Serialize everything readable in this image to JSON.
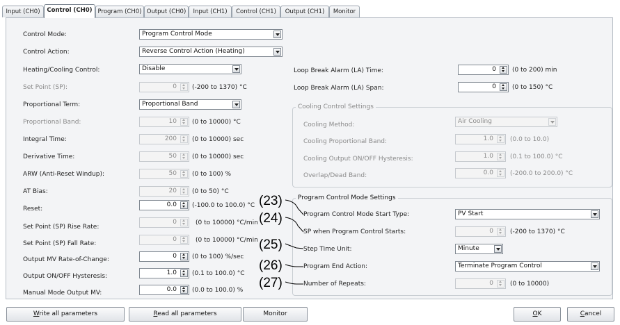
{
  "tabs": [
    {
      "label": "Input (CH0)",
      "active": false
    },
    {
      "label": "Control (CH0)",
      "active": true
    },
    {
      "label": "Program (CH0)",
      "active": false
    },
    {
      "label": "Output (CH0)",
      "active": false
    },
    {
      "label": "Input (CH1)",
      "active": false
    },
    {
      "label": "Control (CH1)",
      "active": false
    },
    {
      "label": "Output (CH1)",
      "active": false
    },
    {
      "label": "Monitor",
      "active": false
    }
  ],
  "left": {
    "control_mode": {
      "label": "Control Mode:",
      "value": "Program Control Mode"
    },
    "control_action": {
      "label": "Control Action:",
      "value": "Reverse Control Action (Heating)"
    },
    "heating_cooling": {
      "label": "Heating/Cooling Control:",
      "value": "Disable"
    },
    "set_point": {
      "label": "Set Point (SP):",
      "value": "0",
      "range": "(-200 to 1370) °C"
    },
    "proportional_term": {
      "label": "Proportional Term:",
      "value": "Proportional Band"
    },
    "proportional_band": {
      "label": "Proportional Band:",
      "value": "10",
      "range": "(0 to 10000) °C"
    },
    "integral_time": {
      "label": "Integral Time:",
      "value": "200",
      "range": "(0 to 10000) sec"
    },
    "derivative_time": {
      "label": "Derivative Time:",
      "value": "50",
      "range": "(0 to 10000) sec"
    },
    "arw": {
      "label": "ARW (Anti-Reset Windup):",
      "value": "50",
      "range": "(0 to 100) %"
    },
    "at_bias": {
      "label": "AT Bias:",
      "value": "20",
      "range": "(0 to 50) °C"
    },
    "reset": {
      "label": "Reset:",
      "value": "0.0",
      "range": "(-100.0 to 100.0) °C"
    },
    "sp_rise_rate": {
      "label": "Set Point (SP) Rise Rate:",
      "value": "0",
      "range": "(0 to 10000) °C/min"
    },
    "sp_fall_rate": {
      "label": "Set Point (SP) Fall Rate:",
      "value": "0",
      "range": "(0 to 10000) °C/min"
    },
    "output_mv_rate": {
      "label": "Output MV Rate-of-Change:",
      "value": "0",
      "range": "(0 to 100) %/sec"
    },
    "output_onoff_hyst": {
      "label": "Output ON/OFF Hysteresis:",
      "value": "1.0",
      "range": "(0.1 to 100.0) °C"
    },
    "manual_mode_mv": {
      "label": "Manual Mode Output MV:",
      "value": "0.0",
      "range": "(0.0 to 100.0) %"
    }
  },
  "right": {
    "loop_break_time": {
      "label": "Loop Break Alarm (LA) Time:",
      "value": "0",
      "range": "(0 to 200) min"
    },
    "loop_break_span": {
      "label": "Loop Break Alarm (LA) Span:",
      "value": "0",
      "range": "(0 to 150) °C"
    }
  },
  "cooling_group": {
    "title": "Cooling Control Settings",
    "method": {
      "label": "Cooling Method:",
      "value": "Air Cooling"
    },
    "prop_band": {
      "label": "Cooling Proportional Band:",
      "value": "1.0",
      "range": "(0.0 to 10.0)"
    },
    "onoff_hyst": {
      "label": "Cooling Output ON/OFF Hysteresis:",
      "value": "1.0",
      "range": "(0.1 to 100.0) °C"
    },
    "overlap": {
      "label": "Overlap/Dead Band:",
      "value": "0.0",
      "range": "(-200.0 to 200.0) °C"
    }
  },
  "program_group": {
    "title": "Program Control Mode Settings",
    "start_type": {
      "label": "Program Control Mode Start Type:",
      "value": "PV Start"
    },
    "sp_when_start": {
      "label": "SP when Program Control Starts:",
      "value": "0",
      "range": "(-200 to 1370) °C"
    },
    "step_time_unit": {
      "label": "Step Time Unit:",
      "value": "Minute"
    },
    "end_action": {
      "label": "Program End Action:",
      "value": "Terminate Program Control"
    },
    "repeats": {
      "label": "Number of Repeats:",
      "value": "0",
      "range": "(0 to 10000)"
    }
  },
  "callouts": [
    "(23)",
    "(24)",
    "(25)",
    "(26)",
    "(27)"
  ],
  "buttons": {
    "write_key": "W",
    "write_rest": "rite all parameters",
    "read_key": "R",
    "read_rest": "ead all parameters",
    "monitor": "Monitor",
    "ok_key": "O",
    "ok_rest": "K",
    "cancel_key": "C",
    "cancel_rest": "ancel"
  }
}
